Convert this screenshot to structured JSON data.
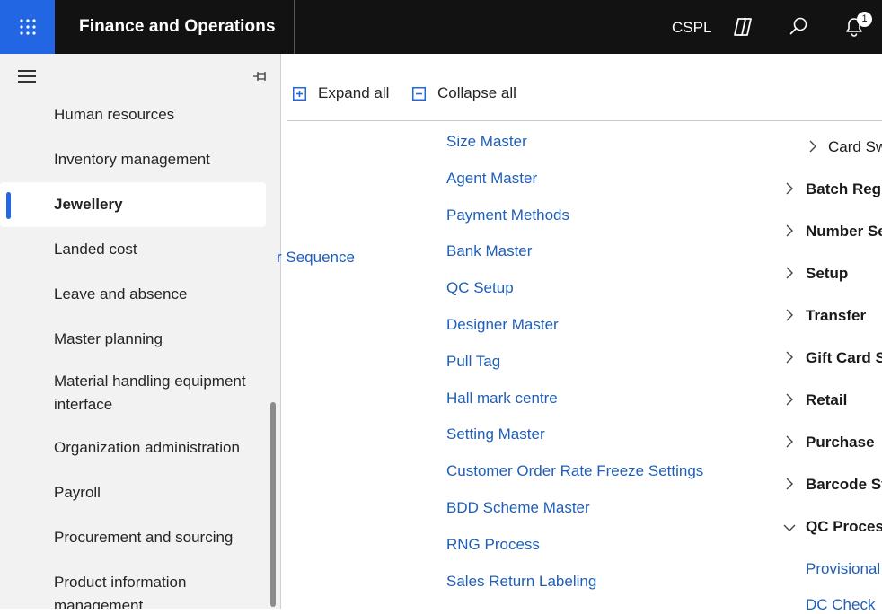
{
  "header": {
    "app_title": "Finance and Operations",
    "company": "CSPL",
    "notification_count": "1",
    "accent_color": "#2266e3"
  },
  "nav": {
    "items": [
      {
        "label": "Human resources"
      },
      {
        "label": "Inventory management"
      },
      {
        "label": "Jewellery",
        "active": true
      },
      {
        "label": "Landed cost"
      },
      {
        "label": "Leave and absence"
      },
      {
        "label": "Master planning"
      },
      {
        "label": "Material handling equipment interface"
      },
      {
        "label": "Organization administration"
      },
      {
        "label": "Payroll"
      },
      {
        "label": "Procurement and sourcing"
      },
      {
        "label": "Product information management"
      }
    ]
  },
  "toolbar": {
    "expand_all": "Expand all",
    "collapse_all": "Collapse all"
  },
  "links": {
    "partial": "r Sequence",
    "column": [
      "Size Master",
      "Agent Master",
      "Payment Methods",
      "Bank Master",
      "QC Setup",
      "Designer Master",
      "Pull Tag",
      "Hall mark centre",
      "Setting Master",
      "Customer Order Rate Freeze Settings",
      "BDD Scheme Master",
      "RNG Process",
      "Sales Return Labeling"
    ]
  },
  "groups": {
    "card_sw": "Card Sw",
    "items": [
      "Batch Regi",
      "Number Se",
      "Setup",
      "Transfer",
      "Gift Card S",
      "Retail",
      "Purchase",
      "Barcode St"
    ],
    "qc_process": "QC Process",
    "qc_children": [
      "Provisional",
      "DC Check"
    ]
  }
}
